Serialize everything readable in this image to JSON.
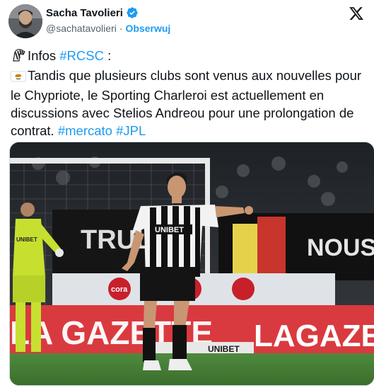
{
  "author": {
    "display_name": "Sacha Tavolieri",
    "handle": "@sachatavolieri",
    "separator": "·",
    "follow_label": "Obserwuj"
  },
  "icons": {
    "verified": "verified-badge-icon",
    "platform": "x-logo-icon",
    "line1_emoji": "zebra-emoji-icon",
    "line2_emoji": "cyprus-flag-emoji-icon"
  },
  "colors": {
    "link": "#1d9bf0",
    "verified": "#1d9bf0",
    "text": "#0f1419",
    "muted": "#536471"
  },
  "tweet": {
    "line1_prefix": "Infos",
    "line1_tag": "#RCSC",
    "line1_suffix": ":",
    "body": "Tandis que plusieurs clubs sont venus aux nouvelles pour le Chypriote, le Sporting Charleroi est actuellement en discussions avec Stelios Andreou pour une prolongation de contrat.",
    "tag1": "#mercato",
    "tag2": "#JPL"
  },
  "media": {
    "shirt_sponsor": "UNIBET",
    "board_left": "LA GAZETTE",
    "board_right": "LAGAZET",
    "board_bottom": "UNIBET",
    "stand_text": "TRULY",
    "banner_text": "NOUS",
    "keeper_sponsor": "UNIBET",
    "board_cora": "cora"
  }
}
